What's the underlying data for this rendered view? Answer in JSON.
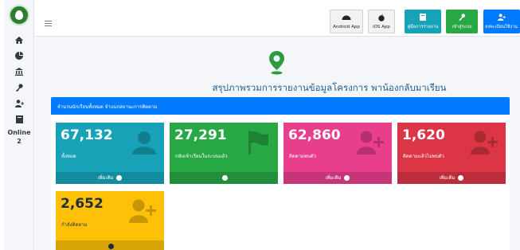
{
  "sidebar": {
    "items": [
      {
        "icon": "home-icon"
      },
      {
        "icon": "pie-chart-icon"
      },
      {
        "icon": "institution-icon"
      },
      {
        "icon": "key-icon"
      },
      {
        "icon": "user-plus-icon"
      },
      {
        "icon": "book-icon"
      }
    ],
    "online_label": "Online",
    "online_count": "2"
  },
  "topbar": {
    "buttons": [
      {
        "label": "Android App",
        "icon": "android-icon"
      },
      {
        "label": "iOS App",
        "icon": "apple-icon"
      },
      {
        "label": "คู่มือการรายงาน",
        "icon": "book-icon"
      },
      {
        "label": "เข้าสู่ระบบ",
        "icon": "key-icon"
      },
      {
        "label": "ลงทะเบียนใช้งาน",
        "icon": "user-plus-icon"
      }
    ]
  },
  "main": {
    "title": "สรุปภาพรวมการรายงานข้อมูลโครงการ พาน้องกลับมาเรียน",
    "card_header": "จำนวนนักเรียนทั้งหมด จำแนกสถานะการติดตาม",
    "stats": [
      {
        "value": "67,132",
        "label": "ทั้งหมด",
        "footer": "เพิ่มเติม",
        "icon": "user-icon"
      },
      {
        "value": "27,291",
        "label": "กลับเข้าเรียนในระบบแล้ว",
        "footer": "",
        "icon": "flag-icon"
      },
      {
        "value": "62,860",
        "label": "ติดตามพบตัว",
        "footer": "เพิ่มเติม",
        "icon": "user-plus-icon"
      },
      {
        "value": "1,620",
        "label": "ติดตามแล้วไม่พบตัว",
        "footer": "เพิ่มเติม",
        "icon": "user-plus-icon"
      },
      {
        "value": "2,652",
        "label": "กำลังติดตาม",
        "footer": "",
        "icon": "user-plus-icon"
      }
    ]
  },
  "colors": {
    "primary": "#007bff",
    "teal": "#17a2b8",
    "green": "#28a745",
    "pink": "#e83e8c",
    "red": "#dc3545",
    "yellow": "#ffc107",
    "title": "#1f5f99",
    "brand": "#2e7d32"
  }
}
